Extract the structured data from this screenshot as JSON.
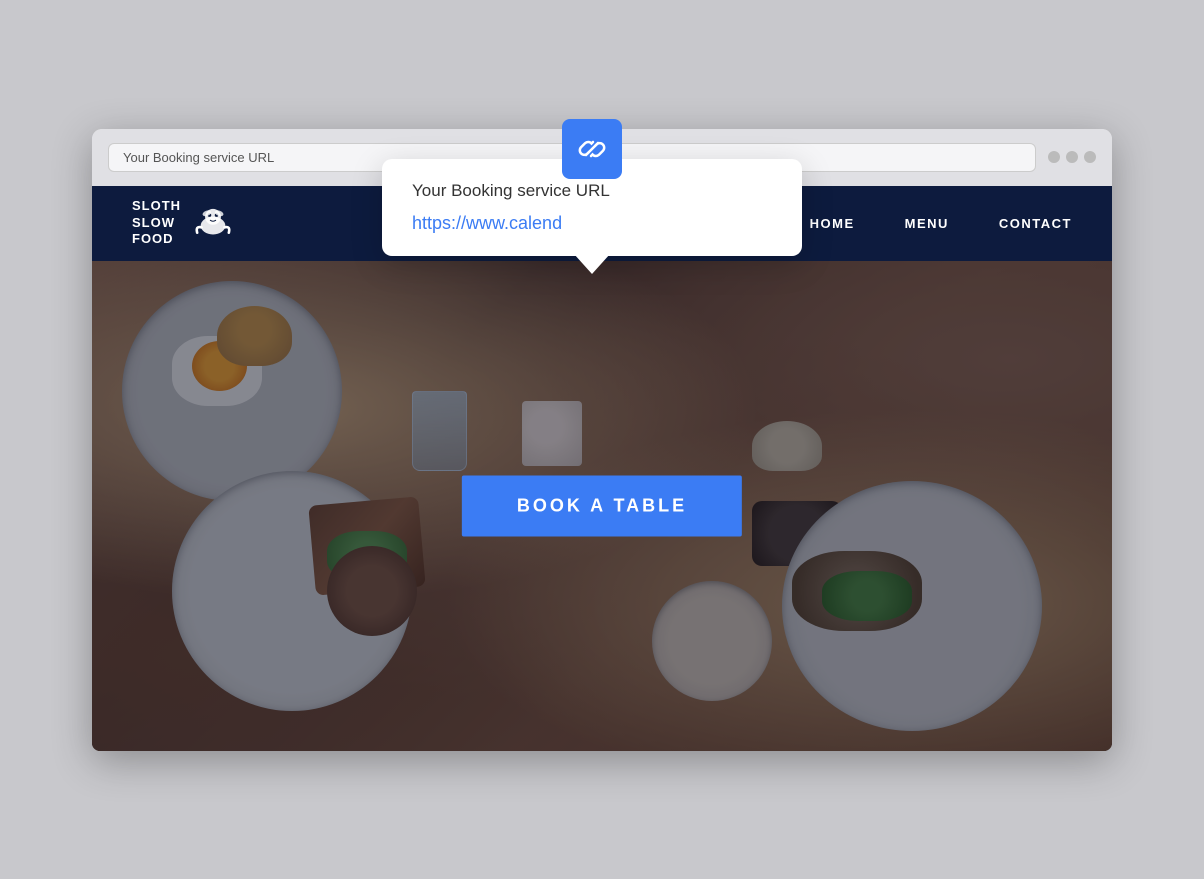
{
  "browser": {
    "address_placeholder": "Your Booking service URL",
    "dots": [
      "dot1",
      "dot2",
      "dot3"
    ]
  },
  "tooltip": {
    "icon_alt": "link-icon",
    "title": "Your Booking service URL",
    "url_value": "https://www.calend"
  },
  "site": {
    "logo": {
      "line1": "SLOTH",
      "line2": "SLOW",
      "line3": "FOOD"
    },
    "nav": {
      "items": [
        "HOME",
        "MENU",
        "CONTACT"
      ]
    },
    "hero": {
      "cta_label": "BOOK A TABLE"
    }
  }
}
